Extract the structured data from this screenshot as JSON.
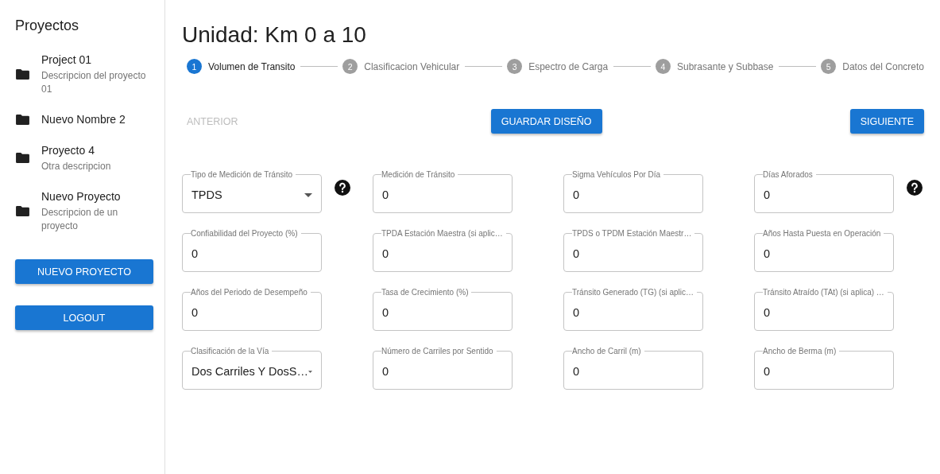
{
  "sidebar": {
    "title": "Proyectos",
    "projects": [
      {
        "name": "Project 01",
        "description": "Descripcion del proyecto 01"
      },
      {
        "name": "Nuevo Nombre 2"
      },
      {
        "name": "Proyecto 4",
        "description": "Otra descripcion"
      },
      {
        "name": "Nuevo Proyecto",
        "description": "Descripcion de un proyecto"
      }
    ],
    "buttons": [
      "NUEVO PROYECTO",
      "LOGOUT"
    ]
  },
  "title": "Unidad: Km 0 a 10",
  "steps": [
    {
      "number": "1",
      "label": "Volumen de Transito",
      "selected": true
    },
    {
      "number": "2",
      "label": "Clasificacion Vehicular",
      "selected": false
    },
    {
      "number": "3",
      "label": "Espectro de Carga",
      "selected": false
    },
    {
      "number": "4",
      "label": "Subrasante y Subbase",
      "selected": false
    },
    {
      "number": "5",
      "label": "Datos del Concreto",
      "selected": false
    }
  ],
  "actions": [
    {
      "label": "ANTERIOR",
      "disabled": true
    },
    {
      "label": "GUARDAR DISEÑO",
      "disabled": false
    },
    {
      "label": "SIGUIENTE",
      "disabled": false
    }
  ],
  "fields": [
    {
      "kind": "select",
      "label": "Tipo de Medición de Tránsito",
      "value": "TPDS",
      "help": true
    },
    {
      "kind": "input",
      "label": "Medición de Tránsito",
      "value": "0",
      "help": false
    },
    {
      "kind": "input",
      "label": "Sigma Vehículos Por Día",
      "value": "0",
      "help": false
    },
    {
      "kind": "input",
      "label": "Días Aforados",
      "value": "0",
      "help": true
    },
    {
      "kind": "input",
      "label": "Confiabilidad del Proyecto (%)",
      "value": "0",
      "help": false
    },
    {
      "kind": "input",
      "label": "TPDA Estación Maestra (si aplic…",
      "value": "0",
      "help": false
    },
    {
      "kind": "input",
      "label": "TPDS o TPDM Estación Maestr…",
      "value": "0",
      "help": false
    },
    {
      "kind": "input",
      "label": "Años Hasta Puesta en Operación",
      "value": "0",
      "help": false
    },
    {
      "kind": "input",
      "label": "Años del Periodo de Desempeño",
      "value": "0",
      "help": false
    },
    {
      "kind": "input",
      "label": "Tasa de Crecimiento (%)",
      "value": "0",
      "help": false
    },
    {
      "kind": "input",
      "label": "Tránsito Generado (TG) (si aplic…",
      "value": "0",
      "help": false
    },
    {
      "kind": "input",
      "label": "Tránsito Atraído (TAt) (si aplica) …",
      "value": "0",
      "help": false
    },
    {
      "kind": "select",
      "label": "Clasificación de la Vía",
      "value": "Dos Carriles Y DosS…",
      "help": false
    },
    {
      "kind": "input",
      "label": "Número de Carriles por Sentido",
      "value": "0",
      "help": false
    },
    {
      "kind": "input",
      "label": "Ancho de Carril (m)",
      "value": "0",
      "help": false
    },
    {
      "kind": "input",
      "label": "Ancho de Berma (m)",
      "value": "0",
      "help": false
    }
  ]
}
